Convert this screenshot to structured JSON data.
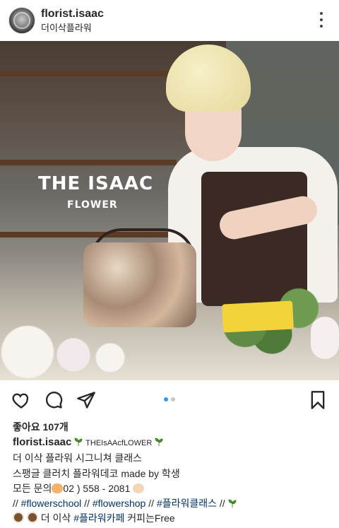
{
  "header": {
    "username": "florist.isaac",
    "location": "더이삭플라워"
  },
  "photo": {
    "overlay_title": "THE ISAAC",
    "overlay_subtitle": "FLOWER",
    "carousel": {
      "count": 2,
      "active_index": 0
    }
  },
  "actions": {
    "like_icon": "heart-icon",
    "comment_icon": "comment-icon",
    "share_icon": "send-icon",
    "save_icon": "bookmark-icon",
    "accent": "#3897f0"
  },
  "likes": "좋아요 107개",
  "caption": {
    "username": "florist.isaac",
    "tag": "THEIsAAcfLOWER",
    "line1": "더 이삭 플라워 시그니쳐 클래스",
    "line2": "스팽글 클러치 플라워데코 made by 학생",
    "line3_prefix": "모든 문의",
    "line3_phone": "02 ) 558 - 2081",
    "line4_sep1": "// ",
    "hashtag1": "#flowerschool",
    "line4_sep2": " // ",
    "hashtag2": "#flowershop",
    "line4_sep3": " // ",
    "hashtag3": "#플라워클래스",
    "line4_sep4": " //",
    "line5_prefix": "더 이삭 ",
    "hashtag4": "#플라워카페",
    "line5_suffix": " 커피는Free"
  }
}
